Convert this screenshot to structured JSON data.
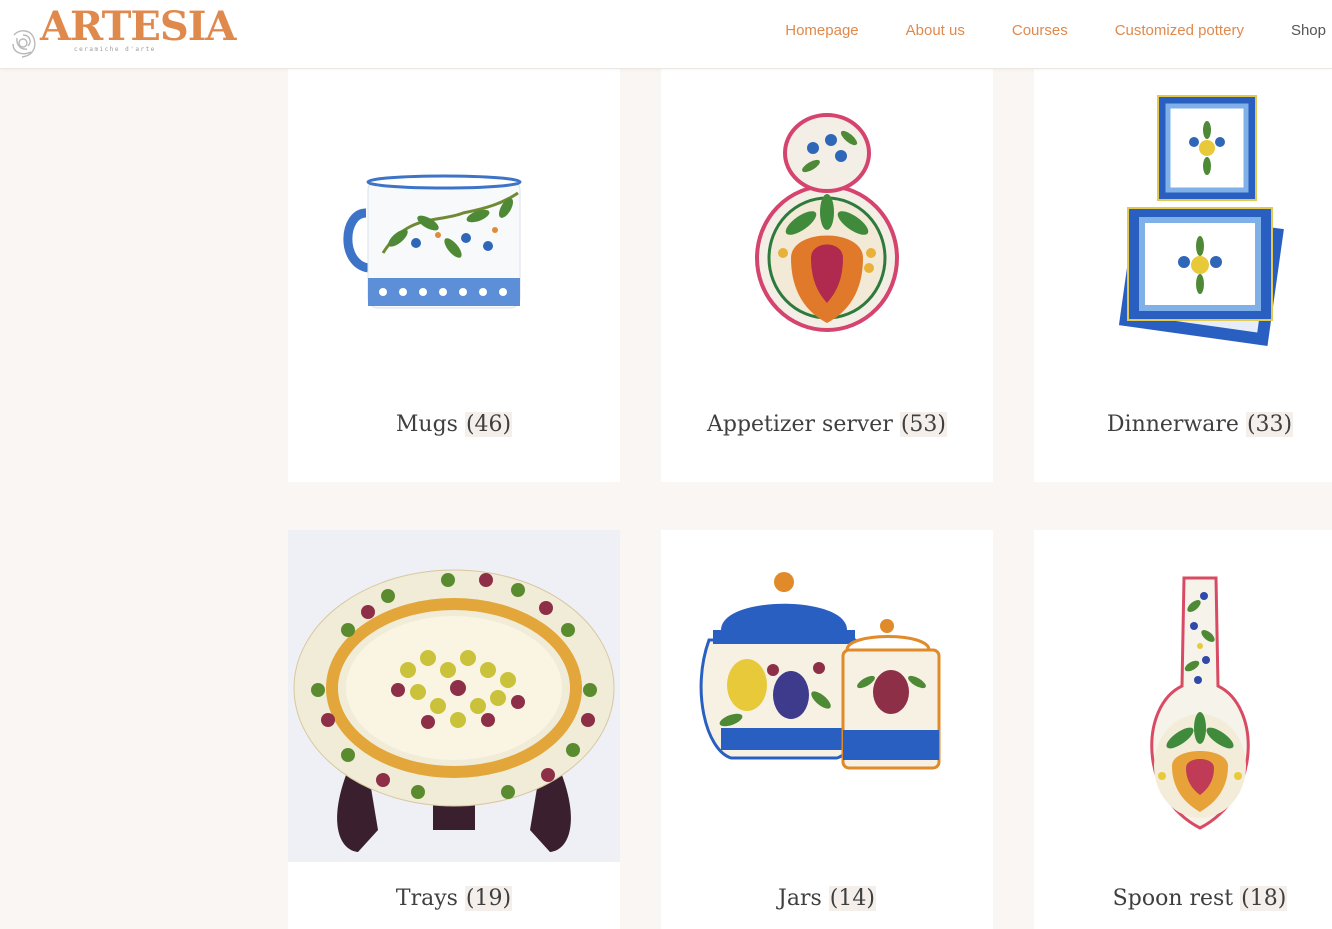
{
  "header": {
    "logo_text": "ARTESIA",
    "logo_tagline": "ceramiche d'arte",
    "nav": [
      {
        "label": "Homepage"
      },
      {
        "label": "About us"
      },
      {
        "label": "Courses"
      },
      {
        "label": "Customized pottery"
      },
      {
        "label": "Shop"
      }
    ]
  },
  "categories": [
    {
      "name": "Mugs",
      "count": "(46)"
    },
    {
      "name": "Appetizer server",
      "count": "(53)"
    },
    {
      "name": "Dinnerware",
      "count": "(33)"
    },
    {
      "name": "Trays",
      "count": "(19)"
    },
    {
      "name": "Jars",
      "count": "(14)"
    },
    {
      "name": "Spoon rest",
      "count": "(18)"
    }
  ],
  "colors": {
    "accent": "#e0894c",
    "background": "#faf6f3",
    "card": "#ffffff",
    "text": "#3f3f3f"
  }
}
